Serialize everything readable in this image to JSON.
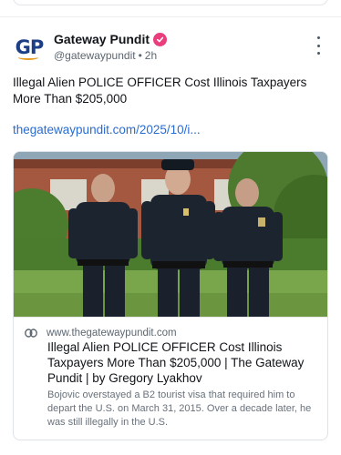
{
  "post": {
    "author": {
      "display_name": "Gateway Pundit",
      "handle": "@gatewaypundit",
      "timestamp": "2h",
      "avatar_text": "GP",
      "verified": true,
      "verified_color": "#ea3d7e"
    },
    "text": "Illegal Alien POLICE OFFICER Cost Illinois Taxpayers More Than $205,000",
    "link_text": "thegatewaypundit.com/2025/10/i...",
    "link_color": "#2a6bd2",
    "link_card": {
      "domain": "www.thegatewaypundit.com",
      "title": "Illegal Alien POLICE OFFICER Cost Illinois Taxpayers More Than $205,000 | The Gateway Pundit | by Gregory Lyakhov",
      "description": "Bojovic overstayed a B2 tourist visa that required him to depart the U.S. on March 31, 2015. Over a decade later, he was still illegally in the U.S.",
      "image": "three-police-officers-photo"
    }
  },
  "icons": {
    "more": "more-vertical-icon",
    "link": "link-icon",
    "verified": "verified-badge-icon"
  }
}
